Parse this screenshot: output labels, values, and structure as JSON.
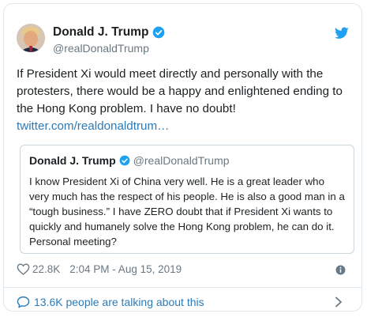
{
  "tweet": {
    "author_name": "Donald J. Trump",
    "author_handle": "@realDonaldTrump",
    "text": "If President Xi would meet directly and personally with the protesters, there would be a happy and enlightened ending to the Hong Kong problem. I have no doubt!",
    "link_text": "twitter.com/realdonaldtrum…",
    "likes": "22.8K",
    "timestamp": "2:04 PM - Aug 15, 2019"
  },
  "quoted": {
    "author_name": "Donald J. Trump",
    "author_handle": "@realDonaldTrump",
    "text": "I know President Xi of China very well. He is a great leader who very much has the respect of his people. He is also a good man in a “tough business.” I have ZERO doubt that if President Xi wants to quickly and humanely solve the Hong Kong problem, he can do it. Personal meeting?"
  },
  "footer": {
    "conversation_text": "13.6K people are talking about this"
  },
  "icons": {
    "verified": "verified-badge-icon",
    "bird": "twitter-bird-icon",
    "heart": "heart-icon",
    "info": "info-icon",
    "bubble": "speech-bubble-icon",
    "chevron": "chevron-right-icon"
  },
  "colors": {
    "accent": "#1da1f2",
    "link": "#2b7bb9",
    "secondary_text": "#697882",
    "border": "#e1e8ed"
  }
}
